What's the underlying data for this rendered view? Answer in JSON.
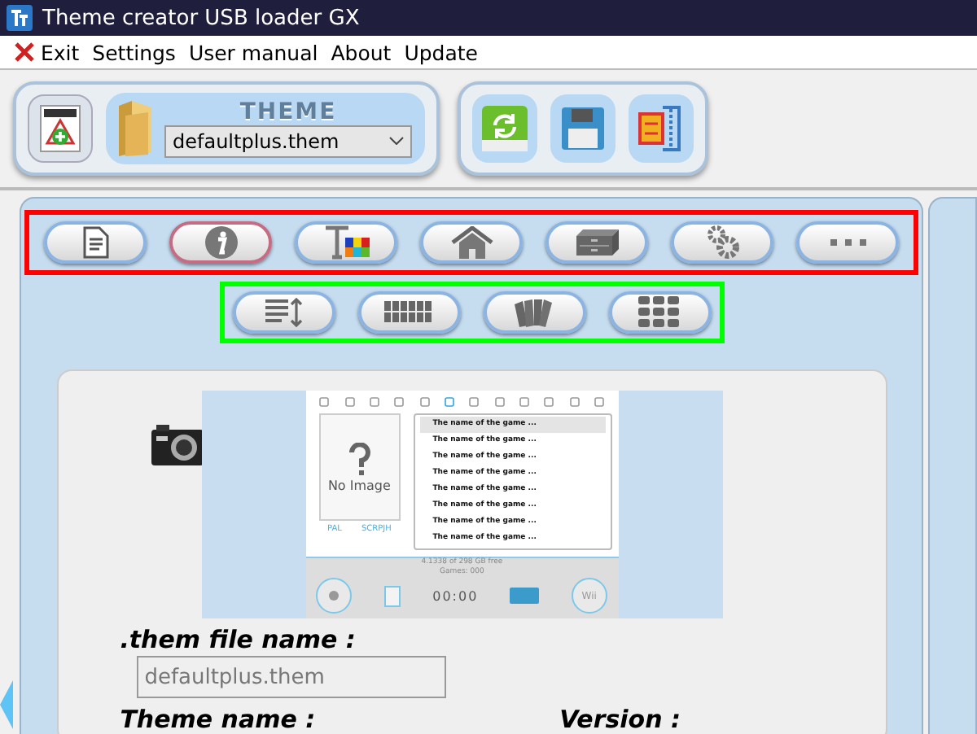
{
  "window": {
    "title": "Theme creator USB loader GX"
  },
  "menu": [
    {
      "label": "Exit",
      "kind": "exit"
    },
    {
      "label": "Settings",
      "kind": "text"
    },
    {
      "label": "User manual",
      "kind": "text"
    },
    {
      "label": "About",
      "kind": "text"
    },
    {
      "label": "Update",
      "kind": "text"
    }
  ],
  "theme_selector": {
    "banner": "THEME",
    "value": "defaultplus.them"
  },
  "main_tabs": [
    {
      "kind": "document",
      "selected": false
    },
    {
      "kind": "info",
      "selected": true
    },
    {
      "kind": "text-colors",
      "selected": false
    },
    {
      "kind": "home",
      "selected": false
    },
    {
      "kind": "drawer",
      "selected": false
    },
    {
      "kind": "gears",
      "selected": false
    },
    {
      "kind": "more",
      "selected": false
    }
  ],
  "sub_tabs": [
    {
      "kind": "list",
      "selected": false
    },
    {
      "kind": "grid-wide",
      "selected": false
    },
    {
      "kind": "cards",
      "selected": false
    },
    {
      "kind": "grid",
      "selected": false
    }
  ],
  "preview": {
    "games": [
      "The name of the game ...",
      "The name of the game ...",
      "The name of the game ...",
      "The name of the game ...",
      "The name of the game ...",
      "The name of the game ...",
      "The name of the game ...",
      "The name of the game ..."
    ],
    "cover_label": "No Image",
    "region": "PAL",
    "game_id": "SCRPJH",
    "free_space": "4.1338 of 298 GB free",
    "games_count": "Games: 000",
    "clock": "00:00",
    "wii_label": "Wii"
  },
  "form": {
    "file_name_label": ".them file name :",
    "file_name": "defaultplus.them",
    "theme_name_label": "Theme name :",
    "version_label": "Version :"
  }
}
